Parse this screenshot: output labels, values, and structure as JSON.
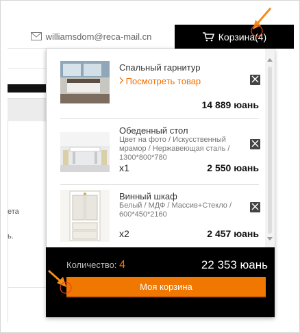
{
  "header": {
    "email": "williamsdom@reca-mail.cn",
    "cart_label": "Корзина(4)"
  },
  "background": {
    "text1": "ета",
    "text2": "ь."
  },
  "cart": {
    "items": [
      {
        "name": "Спальный гарнитур",
        "link": "Посмотреть товар",
        "desc": "",
        "qty": "",
        "price": "14 889 юань"
      },
      {
        "name": "Обеденный стол",
        "link": "",
        "desc": "Цвет на фото / Искусственный мрамор / Нержавеющая сталь / 1300*800*780",
        "qty": "x1",
        "price": "2 550 юань"
      },
      {
        "name": "Винный шкаф",
        "link": "",
        "desc": "Белый / МДФ / Массив+Стекло / 600*450*2160",
        "qty": "x2",
        "price": "2 457 юань"
      }
    ],
    "count_label": "Количество:",
    "count": "4",
    "total": "22 353 юань",
    "button_label": "Моя корзина"
  },
  "colors": {
    "accent": "#f07800",
    "link": "#f26d00",
    "dropdown_bg": "#000000",
    "annotation": "#f28c1e"
  }
}
